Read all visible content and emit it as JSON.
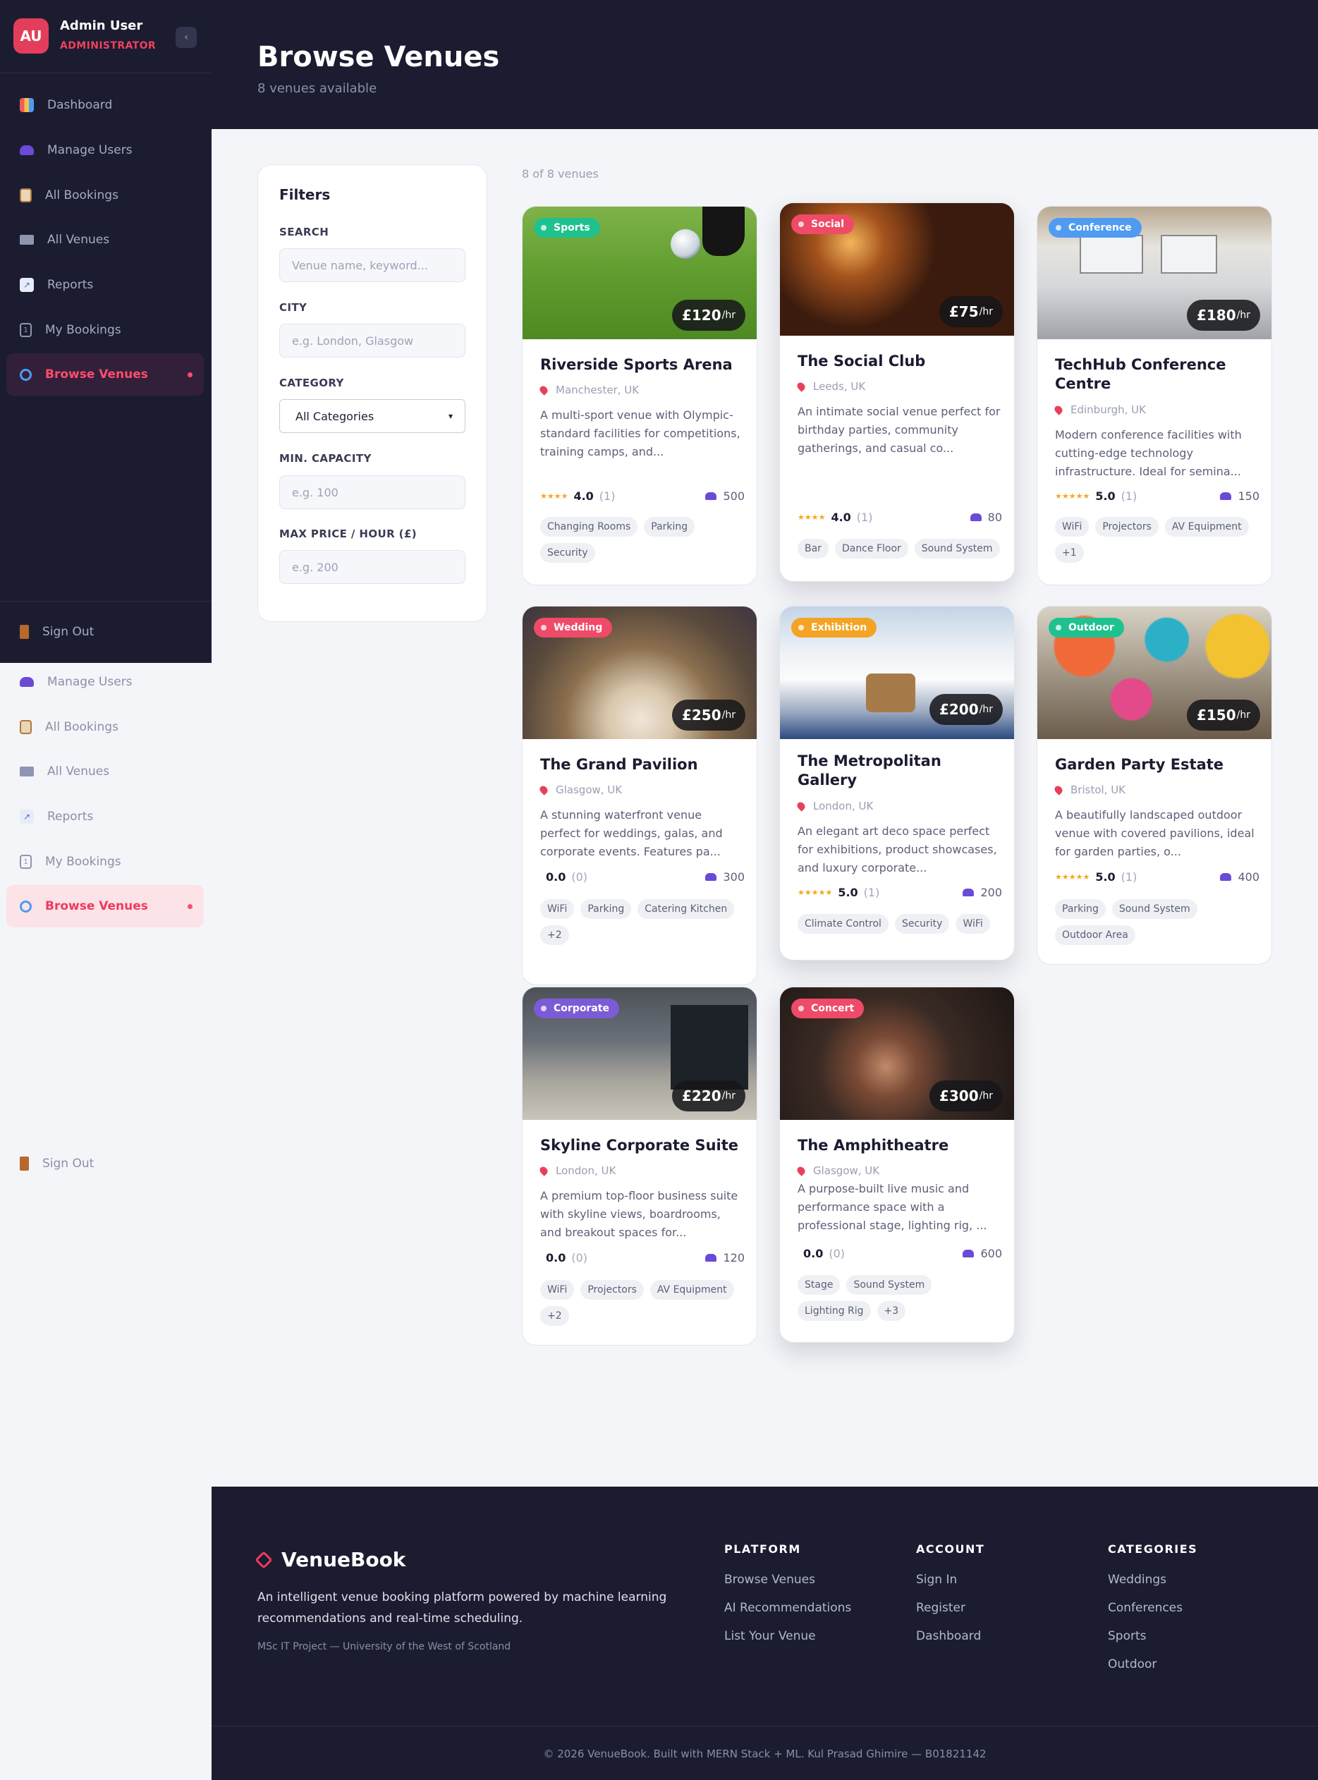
{
  "user": {
    "initials": "AU",
    "name": "Admin User",
    "role": "ADMINISTRATOR"
  },
  "nav": [
    {
      "label": "Dashboard",
      "icon": "dashboard-icon"
    },
    {
      "label": "Manage Users",
      "icon": "users-icon"
    },
    {
      "label": "All Bookings",
      "icon": "clipboard-icon"
    },
    {
      "label": "All Venues",
      "icon": "building-icon"
    },
    {
      "label": "Reports",
      "icon": "chart-icon"
    },
    {
      "label": "My Bookings",
      "icon": "calendar-icon"
    },
    {
      "label": "Browse Venues",
      "icon": "search-icon"
    }
  ],
  "sign_out": "Sign Out",
  "header": {
    "title": "Browse Venues",
    "subtitle": "8 venues available"
  },
  "filters": {
    "title": "Filters",
    "search_label": "SEARCH",
    "search_placeholder": "Venue name, keyword...",
    "city_label": "CITY",
    "city_placeholder": "e.g. London, Glasgow",
    "category_label": "CATEGORY",
    "category_value": "All Categories",
    "capacity_label": "MIN. CAPACITY",
    "capacity_placeholder": "e.g. 100",
    "price_label": "MAX PRICE / HOUR (£)",
    "price_placeholder": "e.g. 200"
  },
  "results_count": "8 of 8 venues",
  "venues": [
    {
      "name": "Riverside Sports Arena",
      "category": "Sports",
      "price": "£120",
      "unit": "/hr",
      "location": "Manchester, UK",
      "description": "A multi-sport venue with Olympic-standard facilities for competitions, training camps, and...",
      "stars": "★★★★",
      "rating": "4.0",
      "reviews": "(1)",
      "capacity": "500",
      "tags": [
        "Changing Rooms",
        "Parking",
        "Security"
      ],
      "badge_color": "#1fc28e"
    },
    {
      "name": "The Social Club",
      "category": "Social",
      "price": "£75",
      "unit": "/hr",
      "location": "Leeds, UK",
      "description": "An intimate social venue perfect for birthday parties, community gatherings, and casual co...",
      "stars": "★★★★",
      "rating": "4.0",
      "reviews": "(1)",
      "capacity": "80",
      "tags": [
        "Bar",
        "Dance Floor",
        "Sound System"
      ],
      "badge_color": "#ef4a68"
    },
    {
      "name": "TechHub Conference Centre",
      "category": "Conference",
      "price": "£180",
      "unit": "/hr",
      "location": "Edinburgh, UK",
      "description": "Modern conference facilities with cutting-edge technology infrastructure. Ideal for semina...",
      "stars": "★★★★★",
      "rating": "5.0",
      "reviews": "(1)",
      "capacity": "150",
      "tags": [
        "WiFi",
        "Projectors",
        "AV Equipment",
        "+1"
      ],
      "badge_color": "#4f9bf2"
    },
    {
      "name": "The Grand Pavilion",
      "category": "Wedding",
      "price": "£250",
      "unit": "/hr",
      "location": "Glasgow, UK",
      "description": "A stunning waterfront venue perfect for weddings, galas, and corporate events. Features pa...",
      "stars": "",
      "rating": "0.0",
      "reviews": "(0)",
      "capacity": "300",
      "tags": [
        "WiFi",
        "Parking",
        "Catering Kitchen",
        "+2"
      ],
      "badge_color": "#ef4a68"
    },
    {
      "name": "The Metropolitan Gallery",
      "category": "Exhibition",
      "price": "£200",
      "unit": "/hr",
      "location": "London, UK",
      "description": "An elegant art deco space perfect for exhibitions, product showcases, and luxury corporate...",
      "stars": "★★★★★",
      "rating": "5.0",
      "reviews": "(1)",
      "capacity": "200",
      "tags": [
        "Climate Control",
        "Security",
        "WiFi"
      ],
      "badge_color": "#f4a424"
    },
    {
      "name": "Garden Party Estate",
      "category": "Outdoor",
      "price": "£150",
      "unit": "/hr",
      "location": "Bristol, UK",
      "description": "A beautifully landscaped outdoor venue with covered pavilions, ideal for garden parties, o...",
      "stars": "★★★★★",
      "rating": "5.0",
      "reviews": "(1)",
      "capacity": "400",
      "tags": [
        "Parking",
        "Sound System",
        "Outdoor Area"
      ],
      "badge_color": "#1fc28e"
    },
    {
      "name": "Skyline Corporate Suite",
      "category": "Corporate",
      "price": "£220",
      "unit": "/hr",
      "location": "London, UK",
      "description": "A premium top-floor business suite with skyline views, boardrooms, and breakout spaces for...",
      "stars": "",
      "rating": "0.0",
      "reviews": "(0)",
      "capacity": "120",
      "tags": [
        "WiFi",
        "Projectors",
        "AV Equipment",
        "+2"
      ],
      "badge_color": "#7c5bd6"
    },
    {
      "name": "The Amphitheatre",
      "category": "Concert",
      "price": "£300",
      "unit": "/hr",
      "location": "Glasgow, UK",
      "description": "A purpose-built live music and performance space with a professional stage, lighting rig, ...",
      "stars": "",
      "rating": "0.0",
      "reviews": "(0)",
      "capacity": "600",
      "tags": [
        "Stage",
        "Sound System",
        "Lighting Rig",
        "+3"
      ],
      "badge_color": "#ef4a68"
    }
  ],
  "footer": {
    "brand": "VenueBook",
    "tagline": "An intelligent venue booking platform powered by machine learning recommendations and real-time scheduling.",
    "credit": "MSc IT Project — University of the West of Scotland",
    "columns": [
      {
        "heading": "PLATFORM",
        "links": [
          "Browse Venues",
          "AI Recommendations",
          "List Your Venue"
        ]
      },
      {
        "heading": "ACCOUNT",
        "links": [
          "Sign In",
          "Register",
          "Dashboard"
        ]
      },
      {
        "heading": "CATEGORIES",
        "links": [
          "Weddings",
          "Conferences",
          "Sports",
          "Outdoor"
        ]
      }
    ],
    "copyright": "© 2026 VenueBook. Built with MERN Stack + ML. Kul Prasad Ghimire — B01821142"
  }
}
